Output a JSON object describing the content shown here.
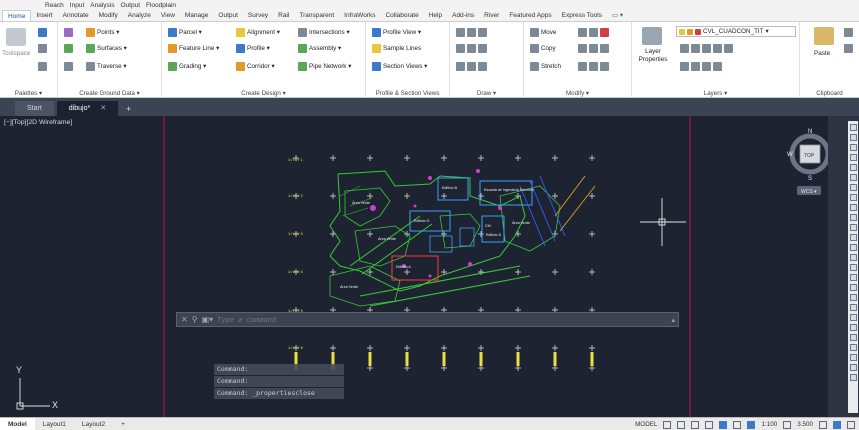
{
  "menubar": [
    "Reach",
    "Input",
    "Analysis",
    "Output",
    "Floodplain"
  ],
  "ribbon_tabs": [
    "Home",
    "Insert",
    "Annotate",
    "Modify",
    "Analyze",
    "View",
    "Manage",
    "Output",
    "Survey",
    "Rail",
    "Transparent",
    "InfraWorks",
    "Collaborate",
    "Help",
    "Add-ins",
    "River",
    "Featured Apps",
    "Express Tools"
  ],
  "ribbon_tabs_extra": "▭ ▾",
  "panels": {
    "palettes": {
      "title": "Palettes ▾",
      "toolspace": "Toolspace"
    },
    "ground": {
      "title": "Create Ground Data ▾",
      "points": "Points ▾",
      "surfaces": "Surfaces ▾",
      "traverse": "Traverse ▾"
    },
    "design": {
      "title": "Create Design ▾",
      "parcel": "Parcel ▾",
      "feature_line": "Feature Line ▾",
      "grading": "Grading ▾",
      "alignment": "Alignment ▾",
      "profile": "Profile ▾",
      "corridor": "Corridor ▾",
      "intersections": "Intersections ▾",
      "assembly": "Assembly ▾",
      "pipe_network": "Pipe Network ▾"
    },
    "profile_section": {
      "title": "Profile & Section Views",
      "profile_view": "Profile View ▾",
      "sample_lines": "Sample Lines",
      "section_views": "Section Views ▾"
    },
    "draw": {
      "title": "Draw ▾"
    },
    "modify": {
      "title": "Modify ▾",
      "move": "Move",
      "copy": "Copy",
      "stretch": "Stretch"
    },
    "layers": {
      "title": "Layers ▾",
      "layer_properties": "Layer Properties",
      "current_layer": "CVL_CUADCON_TIT"
    },
    "clipboard": {
      "title": "Clipboard",
      "paste": "Paste"
    }
  },
  "file_tabs": [
    "Start",
    "dibujo*"
  ],
  "viewport_label": "[−][Top][2D Wireframe]",
  "viewcube": {
    "top": "TOP",
    "n": "N",
    "s": "S",
    "e": "E",
    "w": "W",
    "wcs": "WCS ▾"
  },
  "ucs": {
    "x": "X",
    "y": "Y"
  },
  "drawing": {
    "y_labels": [
      "1=Y=Y 1",
      "1=Y=Y 2",
      "1=Y=Y 3",
      "1=Y=Y 4",
      "1=Y=Y 5",
      "1=Y=Y 6"
    ],
    "building_labels": [
      "Edificio B",
      "Escuela de Ingeniería Eléctrica",
      "Edificio G",
      "Edificio A",
      "CM",
      "Edificio D",
      "Área Verde",
      "Área Verde",
      "Área Verde",
      "Área Verde"
    ]
  },
  "command_history": [
    "Command:",
    "Command:",
    "Command: _propertiesclose"
  ],
  "command_placeholder": "Type a command",
  "layout_tabs": [
    "Model",
    "Layout1",
    "Layout2",
    "+"
  ],
  "status_right": {
    "model": "MODEL",
    "scale": "1:100",
    "value": "3.500"
  },
  "colors": {
    "canvas": "#1e2331",
    "accent": "#3b79c9"
  }
}
